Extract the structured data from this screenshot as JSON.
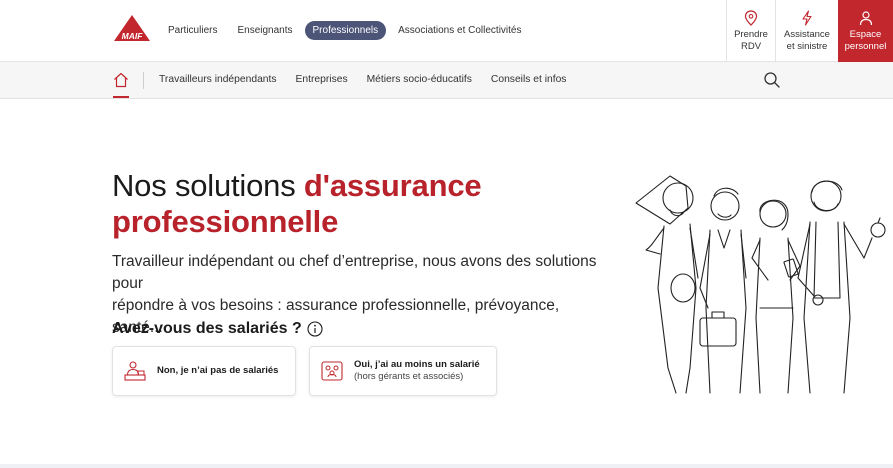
{
  "header": {
    "logo_text": "MAIF",
    "nav": [
      {
        "label": "Particuliers",
        "active": false
      },
      {
        "label": "Enseignants",
        "active": false
      },
      {
        "label": "Professionnels",
        "active": true
      },
      {
        "label": "Associations et Collectivités",
        "active": false
      }
    ],
    "quick_links": {
      "rdv": {
        "line1": "Prendre",
        "line2": "RDV",
        "icon": "location-pin-icon"
      },
      "assistance": {
        "line1": "Assistance",
        "line2": "et sinistre",
        "icon": "lightning-icon"
      },
      "espace": {
        "line1": "Espace",
        "line2": "personnel",
        "icon": "user-icon"
      }
    }
  },
  "subnav": {
    "home_icon": "home-icon",
    "items": [
      "Travailleurs indépendants",
      "Entreprises",
      "Métiers socio-éducatifs",
      "Conseils et infos"
    ],
    "search_icon": "search-icon"
  },
  "hero": {
    "title_plain": "Nos solutions ",
    "title_accent_1": "d'assurance",
    "title_accent_2": "professionnelle",
    "lead_line1": "Travailleur indépendant ou chef d’entreprise, nous avons des solutions pour",
    "lead_line2": "répondre à vos besoins : assurance professionnelle, prévoyance, santé...",
    "question": "Avez-vous des salariés ?",
    "cards": [
      {
        "title": "Non, je n’ai pas de salariés",
        "subtitle": ""
      },
      {
        "title": "Oui, j’ai au moins un salarié",
        "subtitle": "(hors gérants et associés)"
      }
    ]
  },
  "colors": {
    "brand_red": "#c1272d",
    "nav_active": "#4c5477",
    "title_accent": "#b8232b"
  }
}
